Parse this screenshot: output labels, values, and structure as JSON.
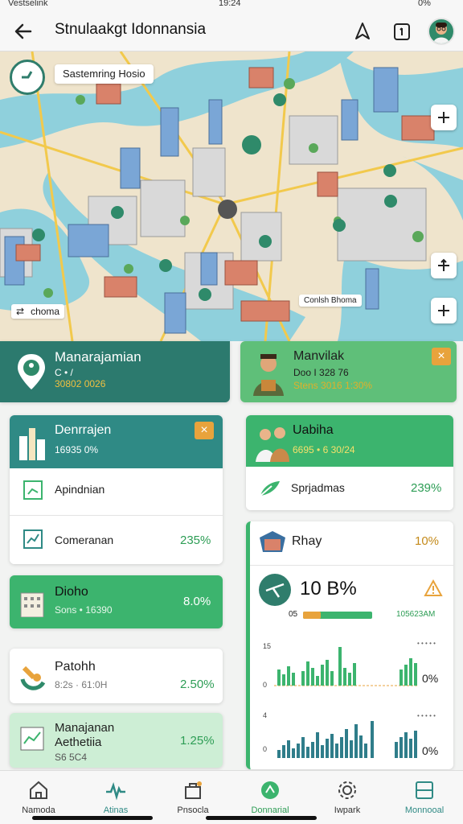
{
  "status": {
    "carrier": "Vestselink",
    "time": "19:24",
    "battery": "0%"
  },
  "header": {
    "title": "Stnulaakgt Idonnansia",
    "back_icon": "arrow-left-icon"
  },
  "map": {
    "search_chip": "Sastemring Hosio",
    "label_left": "choma",
    "label_right": "Conlsh Bhoma",
    "controls": [
      "+",
      "+",
      "+",
      "+"
    ]
  },
  "hero_left": {
    "title": "Manarajamian",
    "line1": "C • /",
    "line2": "30802 0026"
  },
  "hero_right": {
    "title": "Manvilak",
    "line1": "Doo I 328 76",
    "line2": "Stens 3016 1:30%",
    "close": "×"
  },
  "card_a": {
    "title": "Denrrajen",
    "subtitle": "16935 0%",
    "close": "×",
    "rows": [
      {
        "label": "Apindnian",
        "value": ""
      },
      {
        "label": "Comeranan",
        "value": "235%"
      }
    ]
  },
  "card_b": {
    "title": "Dioho",
    "subtitle": "Sons • 16390",
    "value": "8.0%"
  },
  "card_c": {
    "title": "Patohh",
    "subtitle": "8:2s · 61:0H",
    "value": "2.50%"
  },
  "card_d": {
    "title": "Manajanan",
    "title2": "Aethetiia",
    "subtitle": "S6 5C4",
    "value": "1.25%"
  },
  "card_e": {
    "title": "Uabiha",
    "subtitle": "6695 • 6 30/24"
  },
  "card_f": {
    "label": "Sprjadmas",
    "value": "239%"
  },
  "card_g": {
    "title": "Rhay",
    "value": "10%",
    "big_value": "10 B%",
    "progress_left": "05",
    "progress_right": "105623AM",
    "progress": 0.25
  },
  "chart1": {
    "y_labels": [
      "15",
      "0"
    ],
    "right_label": "0%",
    "top_label": "• • • • •"
  },
  "chart2": {
    "y_labels": [
      "4",
      "0"
    ],
    "right_label": "0%",
    "top_label": "• • • • •"
  },
  "nav": [
    {
      "label": "Namoda",
      "icon": "home-icon"
    },
    {
      "label": "Atinas",
      "icon": "activity-icon"
    },
    {
      "label": "Pnsocla",
      "icon": "bag-icon"
    },
    {
      "label": "Donnarial",
      "icon": "compass-icon"
    },
    {
      "label": "Iwpark",
      "icon": "gear-icon"
    },
    {
      "label": "Monnooal",
      "icon": "book-icon"
    }
  ],
  "colors": {
    "teal": "#2f8a85",
    "green": "#3cb46e",
    "orange": "#e8a33c",
    "water": "#8fd0dc"
  }
}
